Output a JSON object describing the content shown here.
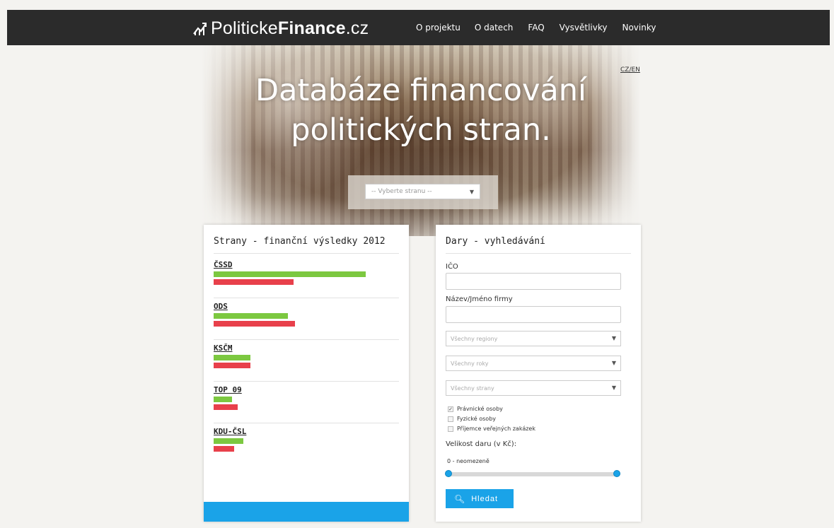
{
  "nav": {
    "brand_light": "Politicke",
    "brand_bold": "Finance",
    "brand_tld": ".cz",
    "links": [
      "O projektu",
      "O datech",
      "FAQ",
      "Vysvětlivky",
      "Novinky"
    ]
  },
  "hero": {
    "lang": "CZ/EN",
    "title_line1": "Databáze financování",
    "title_line2": "politických stran.",
    "party_select_placeholder": "-- Vyberte stranu --"
  },
  "results": {
    "title": "Strany - finanční výsledky 2012",
    "parties": [
      {
        "name": "ČSSD",
        "green": 0.82,
        "red": 0.43
      },
      {
        "name": "ODS",
        "green": 0.4,
        "red": 0.44
      },
      {
        "name": "KSČM",
        "green": 0.2,
        "red": 0.2
      },
      {
        "name": "TOP 09",
        "green": 0.1,
        "red": 0.13
      },
      {
        "name": "KDU-ČSL",
        "green": 0.16,
        "red": 0.11
      }
    ],
    "footer": ""
  },
  "search": {
    "title": "Dary - vyhledávání",
    "ico_label": "IČO",
    "name_label": "Název/Jméno firmy",
    "regions": "Všechny regiony",
    "years": "Všechny roky",
    "parties": "Všechny strany",
    "checkboxes": [
      {
        "label": "Právnické osoby",
        "checked": true
      },
      {
        "label": "Fyzické osoby",
        "checked": false
      },
      {
        "label": "Příjemce veřejných zakázek",
        "checked": false
      }
    ],
    "size_label": "Velikost daru (v Kč):",
    "range_text": "0 - neomezeně",
    "button": "Hledat"
  },
  "colors": {
    "navbar": "#2b2b2b",
    "accent": "#1aa3e8",
    "income": "#7cc840",
    "expense": "#e8404b"
  }
}
